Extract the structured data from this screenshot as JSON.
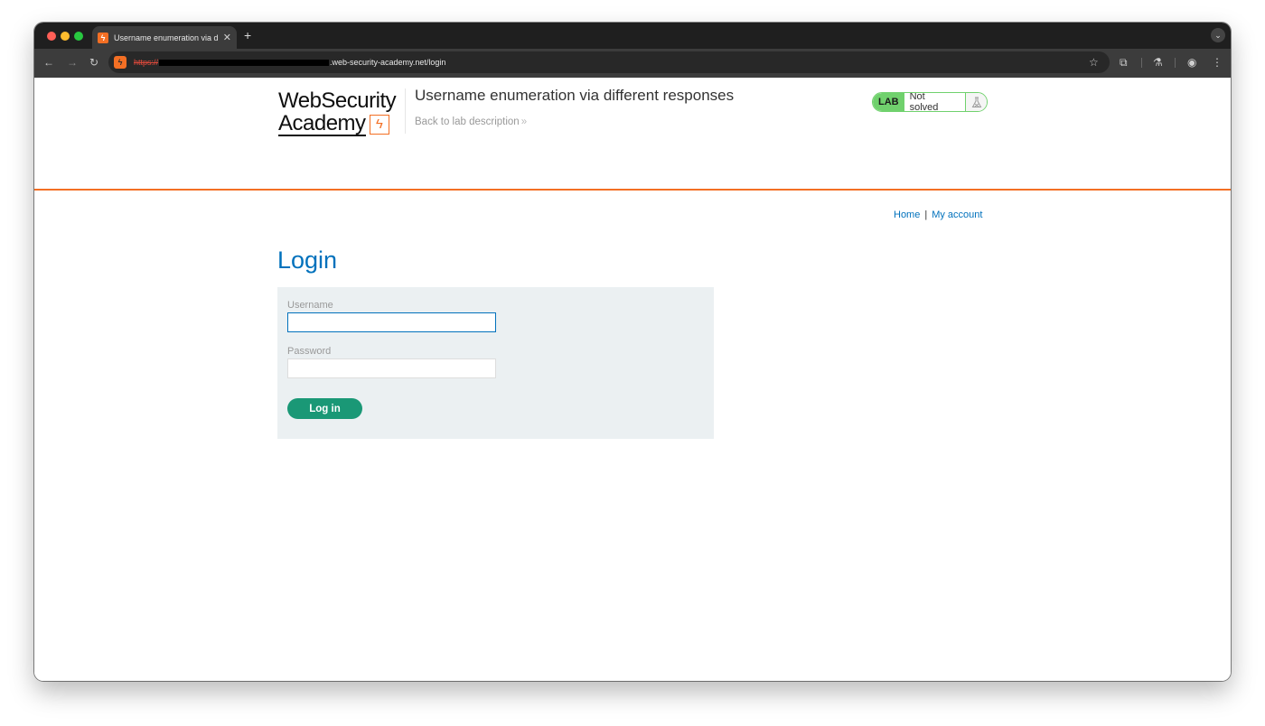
{
  "browser": {
    "tab_title": "Username enumeration via di",
    "url_scheme": "https://",
    "url_visible": ".web-security-academy.net/login"
  },
  "header": {
    "logo_line1": "WebSecurity",
    "logo_line2": "Academy",
    "lab_title": "Username enumeration via different responses",
    "back_link": "Back to lab description",
    "lab_badge": "LAB",
    "lab_status": "Not solved"
  },
  "nav": {
    "home": "Home",
    "separator": "|",
    "my_account": "My account"
  },
  "login": {
    "heading": "Login",
    "username_label": "Username",
    "username_value": "",
    "password_label": "Password",
    "password_value": "",
    "submit_label": "Log in"
  },
  "colors": {
    "brand_orange": "#f36f24",
    "link_blue": "#0071bc",
    "lab_green": "#70d16d",
    "button_green": "#1a9876",
    "panel_bg": "#ebf0f2"
  },
  "icons": [
    "back-icon",
    "forward-icon",
    "reload-icon",
    "bookmark-star-icon",
    "extensions-icon",
    "labs-flask-icon",
    "profile-icon",
    "menu-kebab-icon",
    "flask-icon",
    "logo-bolt-icon"
  ]
}
